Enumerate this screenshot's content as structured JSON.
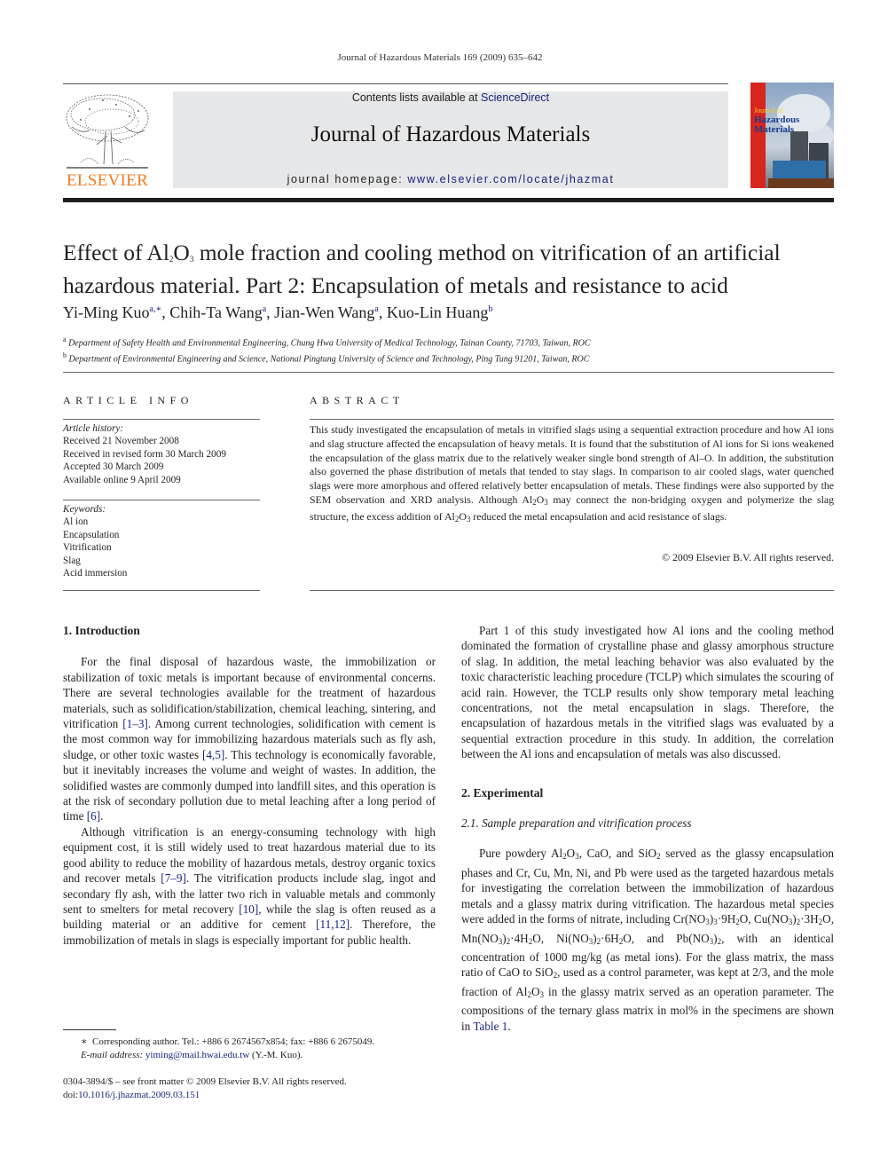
{
  "running_head": "Journal of Hazardous Materials 169 (2009) 635–642",
  "header": {
    "contents_prefix": "Contents lists available at ",
    "contents_link": "ScienceDirect",
    "journal_name": "Journal of Hazardous Materials",
    "homepage_prefix": "journal homepage: ",
    "homepage_link": "www.elsevier.com/locate/jhazmat",
    "publisher_logo_text": "ELSEVIER",
    "cover_title_line1": "Journal of",
    "cover_title_line2": "Hazardous",
    "cover_title_line3": "Materials",
    "colors": {
      "publisher_orange": "#f47b20",
      "link_blue": "#1a237e",
      "banner_gray": "#e6e7e8",
      "cover_red": "#d7261e"
    }
  },
  "article": {
    "title_part1": "Effect of Al",
    "title_sub1": "2",
    "title_part2": "O",
    "title_sub2": "3",
    "title_part3": " mole fraction and cooling method on vitrification of an artificial hazardous material. Part 2: Encapsulation of metals and resistance to acid",
    "authors": [
      {
        "name": "Yi-Ming Kuo",
        "aff": "a,∗",
        "sep": ", "
      },
      {
        "name": "Chih-Ta Wang",
        "aff": "a",
        "sep": ", "
      },
      {
        "name": "Jian-Wen Wang",
        "aff": "a",
        "sep": ", "
      },
      {
        "name": "Kuo-Lin Huang",
        "aff": "b",
        "sep": ""
      }
    ],
    "affiliations": [
      {
        "mark": "a",
        "text": "Department of Safety Health and Environmental Engineering, Chung Hwa University of Medical Technology, Tainan County, 71703, Taiwan, ROC"
      },
      {
        "mark": "b",
        "text": "Department of Environmental Engineering and Science, National Pingtung University of Science and Technology, Ping Tung 91201, Taiwan, ROC"
      }
    ]
  },
  "article_info": {
    "heading": "ARTICLE INFO",
    "history_label": "Article history:",
    "history": [
      "Received 21 November 2008",
      "Received in revised form 30 March 2009",
      "Accepted 30 March 2009",
      "Available online 9 April 2009"
    ],
    "keywords_label": "Keywords:",
    "keywords": [
      "Al ion",
      "Encapsulation",
      "Vitrification",
      "Slag",
      "Acid immersion"
    ]
  },
  "abstract": {
    "heading": "ABSTRACT",
    "text_1": "This study investigated the encapsulation of metals in vitrified slags using a sequential extraction procedure and how Al ions and slag structure affected the encapsulation of heavy metals. It is found that the substitution of Al ions for Si ions weakened the encapsulation of the glass matrix due to the relatively weaker single bond strength of Al–O. In addition, the substitution also governed the phase distribution of metals that tended to stay slags. In comparison to air cooled slags, water quenched slags were more amorphous and offered relatively better encapsulation of metals. These findings were also supported by the SEM observation and XRD analysis. Although Al",
    "text_2": " may connect the non-bridging oxygen and polymerize the slag structure, the excess addition of Al",
    "text_3": " reduced the metal encapsulation and acid resistance of slags.",
    "formula_al": "2",
    "formula_o": "O",
    "formula_o_sub": "3",
    "copyright": "© 2009 Elsevier B.V. All rights reserved."
  },
  "body": {
    "intro_heading": "1.  Introduction",
    "intro_p1_a": "For the final disposal of hazardous waste, the immobilization or stabilization of toxic metals is important because of environmental concerns. There are several technologies available for the treatment of hazardous materials, such as solidification/stabilization, chemical leaching, sintering, and vitrification ",
    "intro_p1_ref1": "[1–3]",
    "intro_p1_b": ". Among current technologies, solidification with cement is the most common way for immobilizing hazardous materials such as fly ash, sludge, or other toxic wastes ",
    "intro_p1_ref2": "[4,5]",
    "intro_p1_c": ". This technology is economically favorable, but it inevitably increases the volume and weight of wastes. In addition, the solidified wastes are commonly dumped into landfill sites, and this operation is at the risk of secondary pollution due to metal leaching after a long period of time ",
    "intro_p1_ref3": "[6]",
    "intro_p1_d": ".",
    "intro_p2_a": "Although vitrification is an energy-consuming technology with high equipment cost, it is still widely used to treat hazardous material due to its good ability to reduce the mobility of hazardous metals, destroy organic toxics and recover metals ",
    "intro_p2_ref1": "[7–9]",
    "intro_p2_b": ". The vitrification products include slag, ingot and secondary fly ash, with the latter two rich in valuable metals and commonly sent to smelters for metal recovery ",
    "intro_p2_ref2": "[10]",
    "intro_p2_c": ", while the slag is often reused as a building material or an additive for cement ",
    "intro_p2_ref3": "[11,12]",
    "intro_p2_d": ". Therefore, the immobilization of metals in slags is especially important for public health.",
    "intro_p3": "Part 1 of this study investigated how Al ions and the cooling method dominated the formation of crystalline phase and glassy amorphous structure of slag. In addition, the metal leaching behavior was also evaluated by the toxic characteristic leaching procedure (TCLP) which simulates the scouring of acid rain. However, the TCLP results only show temporary metal leaching concentrations, not the metal encapsulation in slags. Therefore, the encapsulation of hazardous metals in the vitrified slags was evaluated by a sequential extraction procedure in this study. In addition, the correlation between the Al ions and encapsulation of metals was also discussed.",
    "exp_heading": "2.  Experimental",
    "exp_sub_heading": "2.1.  Sample preparation and vitrification process",
    "exp_p1_a": "Pure powdery Al",
    "exp_p1_b": ", CaO, and SiO",
    "exp_p1_c": " served as the glassy encapsulation phases and Cr, Cu, Mn, Ni, and Pb were used as the targeted hazardous metals for investigating the correlation between the immobilization of hazardous metals and a glassy matrix during vitrification. The hazardous metal species were added in the forms of nitrate, including Cr(NO",
    "exp_p1_d": "·9H",
    "exp_p1_e": "O, Cu(NO",
    "exp_p1_f": "·3H",
    "exp_p1_g": "O, Mn(NO",
    "exp_p1_h": "·4H",
    "exp_p1_i": "O, Ni(NO",
    "exp_p1_j": "·6H",
    "exp_p1_k": "O, and Pb(NO",
    "exp_p1_l": ", with an identical concentration of 1000 mg/kg (as metal ions). For the glass matrix, the mass ratio of CaO to SiO",
    "exp_p1_m": ", used as a control parameter, was kept at 2/3, and the mole fraction of Al",
    "exp_p1_n": " in the glassy matrix served as an operation parameter. The compositions of the ternary glass matrix in mol% in the specimens are shown in ",
    "exp_p1_ref": "Table 1",
    "exp_p1_end": "."
  },
  "footnote": {
    "star": "∗",
    "corresponding": "Corresponding author. Tel.: +886 6 2674567x854; fax: +886 6 2675049.",
    "email_label": "E-mail address: ",
    "email": "yiming@mail.hwai.edu.tw",
    "email_suffix": " (Y.-M. Kuo).",
    "front_matter": "0304-3894/$ – see front matter © 2009 Elsevier B.V. All rights reserved.",
    "doi_label": "doi:",
    "doi": "10.1016/j.jhazmat.2009.03.151"
  }
}
